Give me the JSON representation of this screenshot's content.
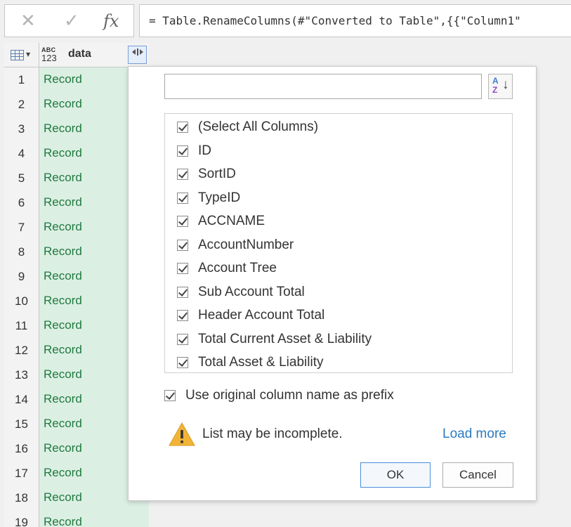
{
  "formula_bar": {
    "cancel_glyph": "✕",
    "commit_glyph": "✓",
    "fx_label": "fx",
    "formula": "= Table.RenameColumns(#\"Converted to Table\",{{\"Column1\""
  },
  "grid": {
    "type_label_top": "ABC",
    "type_label_bottom": "123",
    "column_name": "data",
    "rows": [
      {
        "n": "1",
        "v": "Record"
      },
      {
        "n": "2",
        "v": "Record"
      },
      {
        "n": "3",
        "v": "Record"
      },
      {
        "n": "4",
        "v": "Record"
      },
      {
        "n": "5",
        "v": "Record"
      },
      {
        "n": "6",
        "v": "Record"
      },
      {
        "n": "7",
        "v": "Record"
      },
      {
        "n": "8",
        "v": "Record"
      },
      {
        "n": "9",
        "v": "Record"
      },
      {
        "n": "10",
        "v": "Record"
      },
      {
        "n": "11",
        "v": "Record"
      },
      {
        "n": "12",
        "v": "Record"
      },
      {
        "n": "13",
        "v": "Record"
      },
      {
        "n": "14",
        "v": "Record"
      },
      {
        "n": "15",
        "v": "Record"
      },
      {
        "n": "16",
        "v": "Record"
      },
      {
        "n": "17",
        "v": "Record"
      },
      {
        "n": "18",
        "v": "Record"
      },
      {
        "n": "19",
        "v": "Record"
      }
    ]
  },
  "popup": {
    "search_value": "",
    "columns": [
      {
        "label": "(Select All Columns)",
        "checked": true
      },
      {
        "label": "ID",
        "checked": true
      },
      {
        "label": "SortID",
        "checked": true
      },
      {
        "label": "TypeID",
        "checked": true
      },
      {
        "label": "ACCNAME",
        "checked": true
      },
      {
        "label": "AccountNumber",
        "checked": true
      },
      {
        "label": "Account Tree",
        "checked": true
      },
      {
        "label": "Sub Account Total",
        "checked": true
      },
      {
        "label": "Header Account Total",
        "checked": true
      },
      {
        "label": "Total Current Asset & Liability",
        "checked": true
      },
      {
        "label": "Total Asset & Liability",
        "checked": true
      }
    ],
    "prefix_label": "Use original column name as prefix",
    "prefix_checked": true,
    "warning": "List may be incomplete.",
    "load_more": "Load more",
    "ok": "OK",
    "cancel": "Cancel"
  },
  "colors": {
    "record_text": "#1f7a3f",
    "record_bg": "#dcefe3",
    "link": "#2c79c2",
    "warning": "#e8a317"
  }
}
